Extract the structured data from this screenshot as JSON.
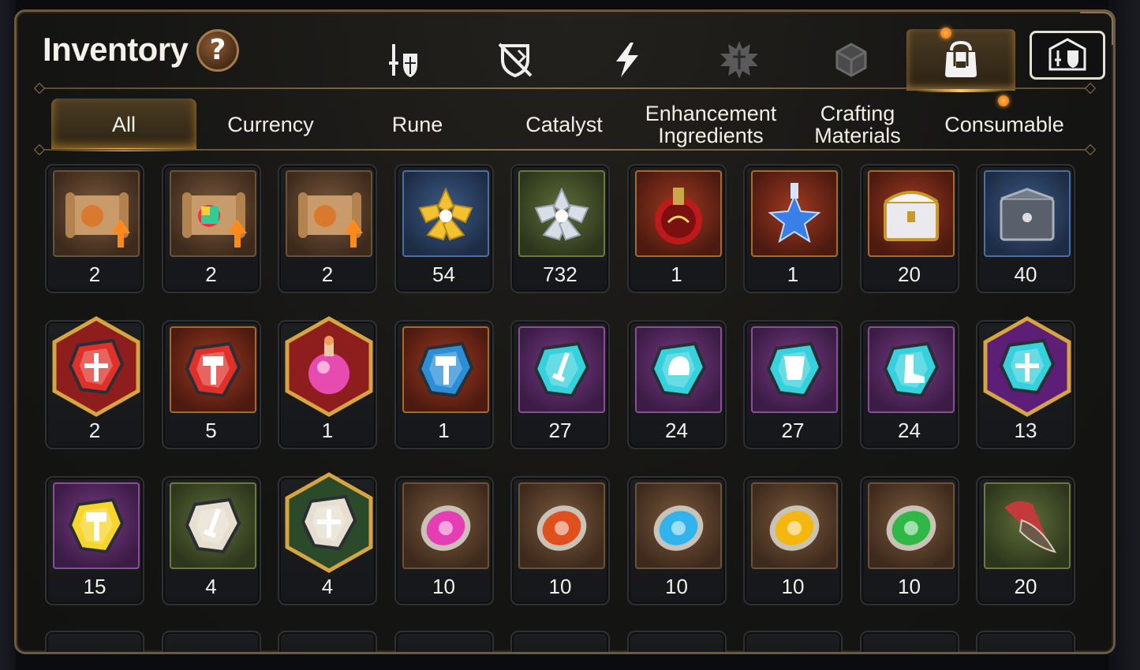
{
  "header": {
    "title": "Inventory",
    "help_label": "?"
  },
  "type_tabs": [
    {
      "name": "gear",
      "icon": "sword-shield-icon"
    },
    {
      "name": "unequipped",
      "icon": "crossed-shield-icon"
    },
    {
      "name": "artifacts",
      "icon": "lightning-icon"
    },
    {
      "name": "spirit",
      "icon": "spiky-emblem-icon"
    },
    {
      "name": "boxes",
      "icon": "dice-box-icon"
    },
    {
      "name": "bag",
      "icon": "bag-icon",
      "active": true
    },
    {
      "name": "guild",
      "icon": "guild-shield-icon"
    }
  ],
  "category_tabs": [
    {
      "label": "All",
      "active": true
    },
    {
      "label": "Currency"
    },
    {
      "label": "Rune"
    },
    {
      "label": "Catalyst"
    },
    {
      "label": "Enhancement Ingredients"
    },
    {
      "label": "Crafting Materials"
    },
    {
      "label": "Consumable"
    }
  ],
  "items": [
    {
      "icon": "scroll-dragon-upgrade-icon",
      "count": "2",
      "frame": "brown"
    },
    {
      "icon": "scroll-rainbow-upgrade-icon",
      "count": "2",
      "frame": "brown"
    },
    {
      "icon": "scroll-rune-upgrade-icon",
      "count": "2",
      "frame": "brown"
    },
    {
      "icon": "gold-crystal-flower-icon",
      "count": "54",
      "frame": "blue"
    },
    {
      "icon": "silver-crystal-flower-icon",
      "count": "732",
      "frame": "green"
    },
    {
      "icon": "red-potion-icon",
      "count": "1",
      "frame": "red"
    },
    {
      "icon": "star-potion-icon",
      "count": "1",
      "frame": "red"
    },
    {
      "icon": "treasure-chest-icon",
      "count": "20",
      "frame": "red"
    },
    {
      "icon": "dark-chest-icon",
      "count": "40",
      "frame": "blue"
    },
    {
      "icon": "red-gem-cross-icon",
      "count": "2",
      "frame": "hex-red"
    },
    {
      "icon": "red-gem-hammer-icon",
      "count": "5",
      "frame": "red"
    },
    {
      "icon": "pink-potion-icon",
      "count": "1",
      "frame": "hex-red"
    },
    {
      "icon": "blue-rune-hammer-icon",
      "count": "1",
      "frame": "red"
    },
    {
      "icon": "cyan-stone-sword-icon",
      "count": "27",
      "frame": "purple"
    },
    {
      "icon": "cyan-stone-helmet-icon",
      "count": "24",
      "frame": "purple"
    },
    {
      "icon": "cyan-stone-armor-icon",
      "count": "27",
      "frame": "purple"
    },
    {
      "icon": "cyan-stone-boot-icon",
      "count": "24",
      "frame": "purple"
    },
    {
      "icon": "cyan-stone-star-icon",
      "count": "13",
      "frame": "hex-purple"
    },
    {
      "icon": "gold-stone-hammer-icon",
      "count": "15",
      "frame": "purple"
    },
    {
      "icon": "white-stone-sword-icon",
      "count": "4",
      "frame": "green"
    },
    {
      "icon": "white-stone-star-icon",
      "count": "4",
      "frame": "hex-green"
    },
    {
      "icon": "magenta-orb-icon",
      "count": "10",
      "frame": "brown"
    },
    {
      "icon": "orange-orb-icon",
      "count": "10",
      "frame": "brown"
    },
    {
      "icon": "cyan-orb-icon",
      "count": "10",
      "frame": "brown"
    },
    {
      "icon": "yellow-orb-icon",
      "count": "10",
      "frame": "brown"
    },
    {
      "icon": "green-orb-icon",
      "count": "10",
      "frame": "brown"
    },
    {
      "icon": "claw-horn-icon",
      "count": "20",
      "frame": "green"
    }
  ],
  "colors": {
    "accent_gold": "#ffc45e",
    "panel_border": "#6c5a3e",
    "notification_dot": "#ff9b2a"
  }
}
